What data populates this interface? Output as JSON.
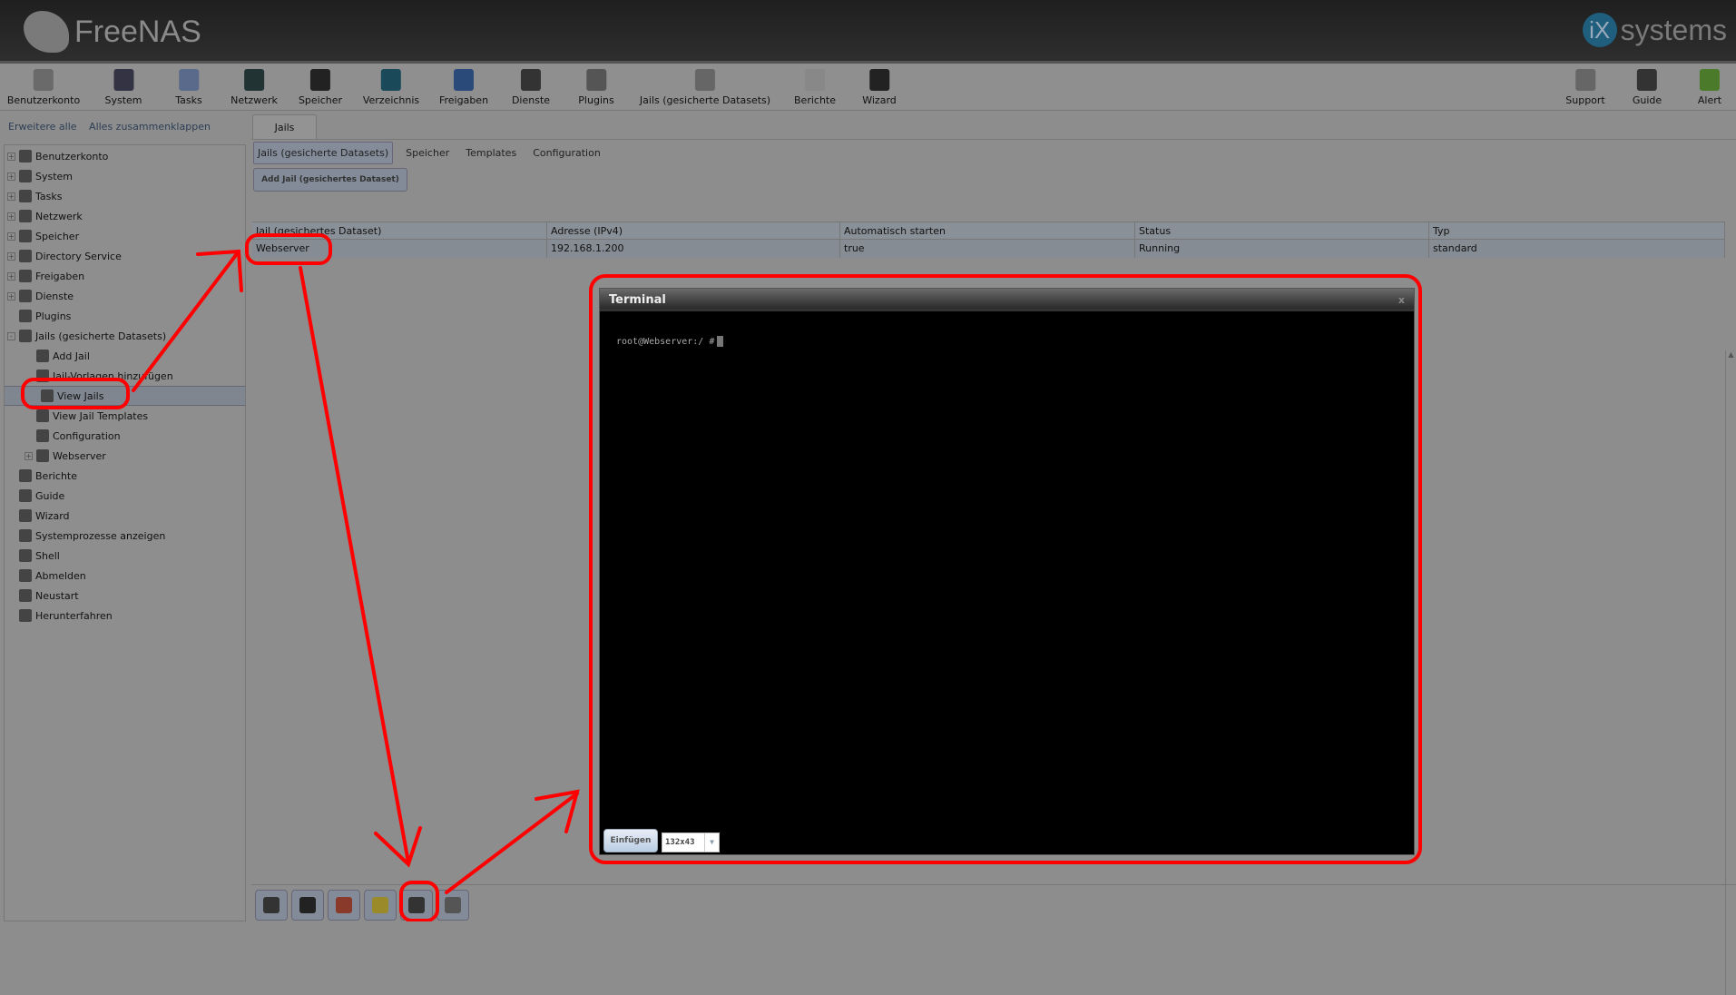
{
  "header": {
    "brand": "FreeNAS",
    "vendor": "systems",
    "vendor_mark": "iX"
  },
  "toolbar": [
    {
      "label": "Benutzerkonto",
      "icon": "users-icon",
      "color": "#6a6a6a"
    },
    {
      "label": "System",
      "icon": "system-icon",
      "color": "#334"
    },
    {
      "label": "Tasks",
      "icon": "tasks-icon",
      "color": "#5a6a8a"
    },
    {
      "label": "Netzwerk",
      "icon": "network-icon",
      "color": "#233"
    },
    {
      "label": "Speicher",
      "icon": "storage-icon",
      "color": "#222"
    },
    {
      "label": "Verzeichnis",
      "icon": "directory-icon",
      "color": "#1a4a5a"
    },
    {
      "label": "Freigaben",
      "icon": "shares-icon",
      "color": "#2a4a7a"
    },
    {
      "label": "Dienste",
      "icon": "services-icon",
      "color": "#333"
    },
    {
      "label": "Plugins",
      "icon": "plugins-icon",
      "color": "#555"
    },
    {
      "label": "Jails (gesicherte Datasets)",
      "icon": "jails-icon",
      "color": "#666"
    },
    {
      "label": "Berichte",
      "icon": "reports-icon",
      "color": "#888"
    },
    {
      "label": "Wizard",
      "icon": "wizard-icon",
      "color": "#222"
    }
  ],
  "toolbar_right": [
    {
      "label": "Support",
      "icon": "support-icon",
      "color": "#666"
    },
    {
      "label": "Guide",
      "icon": "guide-icon",
      "color": "#333"
    },
    {
      "label": "Alert",
      "icon": "alert-icon",
      "color": "#4a7a2a"
    }
  ],
  "sidebar": {
    "expand_all": "Erweitere alle",
    "collapse_all": "Alles zusammenklappen",
    "items": [
      {
        "label": "Benutzerkonto",
        "level": 0,
        "toggle": "+"
      },
      {
        "label": "System",
        "level": 0,
        "toggle": "+"
      },
      {
        "label": "Tasks",
        "level": 0,
        "toggle": "+"
      },
      {
        "label": "Netzwerk",
        "level": 0,
        "toggle": "+"
      },
      {
        "label": "Speicher",
        "level": 0,
        "toggle": "+"
      },
      {
        "label": "Directory Service",
        "level": 0,
        "toggle": "+"
      },
      {
        "label": "Freigaben",
        "level": 0,
        "toggle": "+"
      },
      {
        "label": "Dienste",
        "level": 0,
        "toggle": "+"
      },
      {
        "label": "Plugins",
        "level": 0,
        "toggle": ""
      },
      {
        "label": "Jails (gesicherte Datasets)",
        "level": 0,
        "toggle": "-"
      },
      {
        "label": "Add Jail",
        "level": 1,
        "toggle": ""
      },
      {
        "label": "Jail-Vorlagen hinzufügen",
        "level": 1,
        "toggle": ""
      },
      {
        "label": "View Jails",
        "level": 1,
        "toggle": "",
        "selected": true
      },
      {
        "label": "View Jail Templates",
        "level": 1,
        "toggle": ""
      },
      {
        "label": "Configuration",
        "level": 1,
        "toggle": ""
      },
      {
        "label": "Webserver",
        "level": 1,
        "toggle": "+"
      },
      {
        "label": "Berichte",
        "level": 0,
        "toggle": ""
      },
      {
        "label": "Guide",
        "level": 0,
        "toggle": ""
      },
      {
        "label": "Wizard",
        "level": 0,
        "toggle": ""
      },
      {
        "label": "Systemprozesse anzeigen",
        "level": 0,
        "toggle": ""
      },
      {
        "label": "Shell",
        "level": 0,
        "toggle": ""
      },
      {
        "label": "Abmelden",
        "level": 0,
        "toggle": ""
      },
      {
        "label": "Neustart",
        "level": 0,
        "toggle": ""
      },
      {
        "label": "Herunterfahren",
        "level": 0,
        "toggle": ""
      }
    ]
  },
  "main": {
    "tab": "Jails",
    "subtabs": [
      "Jails (gesicherte Datasets)",
      "Speicher",
      "Templates",
      "Configuration"
    ],
    "add_button": "Add Jail (gesichertes Dataset)",
    "columns": [
      "Jail (gesichertes Dataset)",
      "Adresse (IPv4)",
      "Automatisch starten",
      "Status",
      "Typ"
    ],
    "rows": [
      [
        "Webserver",
        "192.168.1.200",
        "true",
        "Running",
        "standard"
      ]
    ],
    "bottom_buttons": [
      {
        "name": "edit-jail-button",
        "icon": "wrench-icon",
        "color": "#333"
      },
      {
        "name": "storage-button",
        "icon": "folder-icon",
        "color": "#222"
      },
      {
        "name": "stop-button",
        "icon": "stop-icon",
        "color": "#8a3a2a"
      },
      {
        "name": "restart-button",
        "icon": "restart-icon",
        "color": "#9a8a2a"
      },
      {
        "name": "shell-button",
        "icon": "terminal-icon",
        "color": "#333"
      },
      {
        "name": "delete-button",
        "icon": "trash-icon",
        "color": "#555"
      }
    ]
  },
  "terminal": {
    "title": "Terminal",
    "close": "x",
    "prompt": "root@Webserver:/ #",
    "paste_label": "Einfügen",
    "size": "132x43"
  },
  "annotation_color": "#ff0000"
}
